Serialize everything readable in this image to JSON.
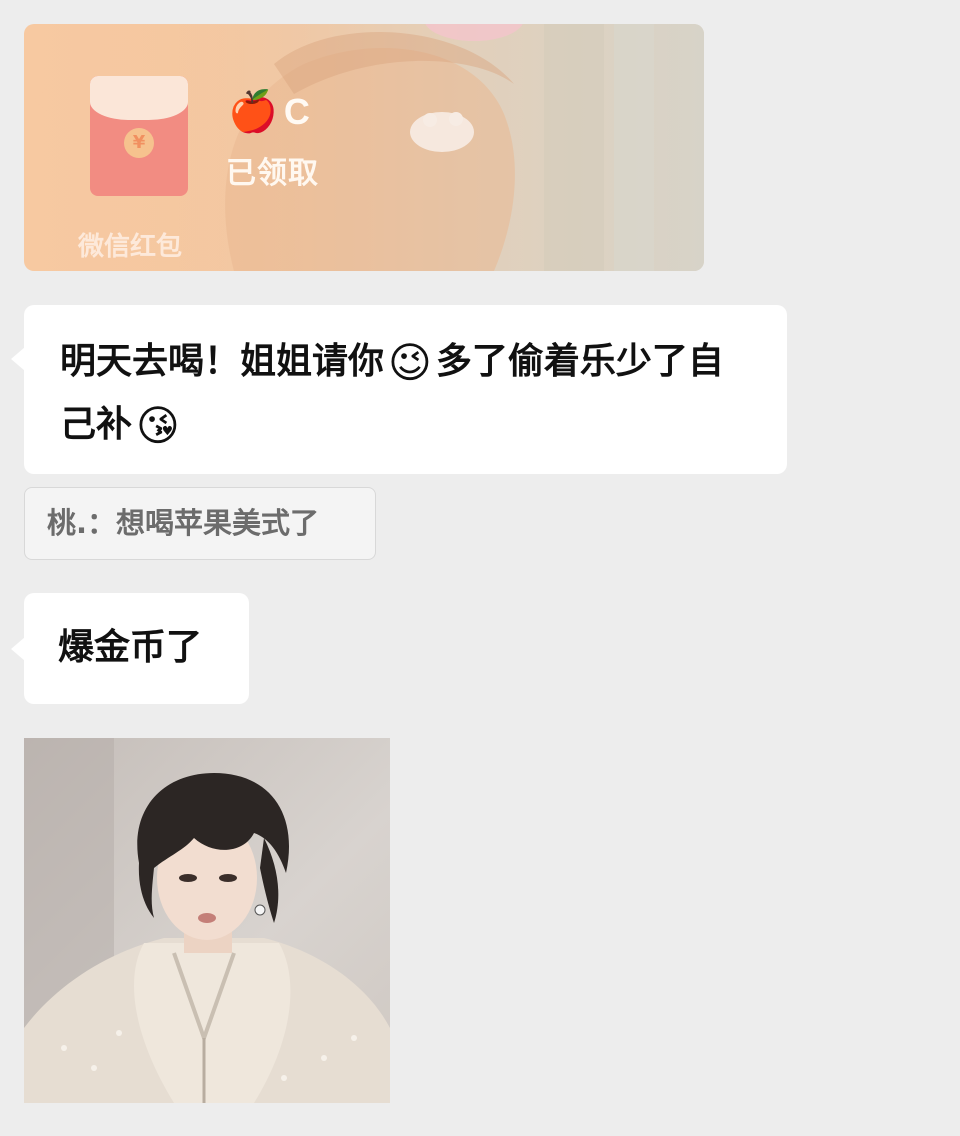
{
  "red_packet": {
    "sender_emoji": "🍎",
    "sender_name": "C",
    "status": "已领取",
    "footer": "微信红包",
    "coin_symbol": "¥",
    "accent_color": "#f28c82"
  },
  "messages": [
    {
      "text_a": "明天去喝！姐姐请你",
      "emoji_a": "😉",
      "text_b": "多了偷着乐少了自己补",
      "emoji_b": "😘"
    },
    {
      "text": "爆金币了"
    }
  ],
  "quote": {
    "text": "桃.：想喝苹果美式了"
  },
  "colors": {
    "chat_background": "#ededed",
    "bubble_background": "#ffffff"
  },
  "icons": {
    "red_envelope": "red-envelope-icon",
    "coin": "yuan-coin-icon"
  }
}
